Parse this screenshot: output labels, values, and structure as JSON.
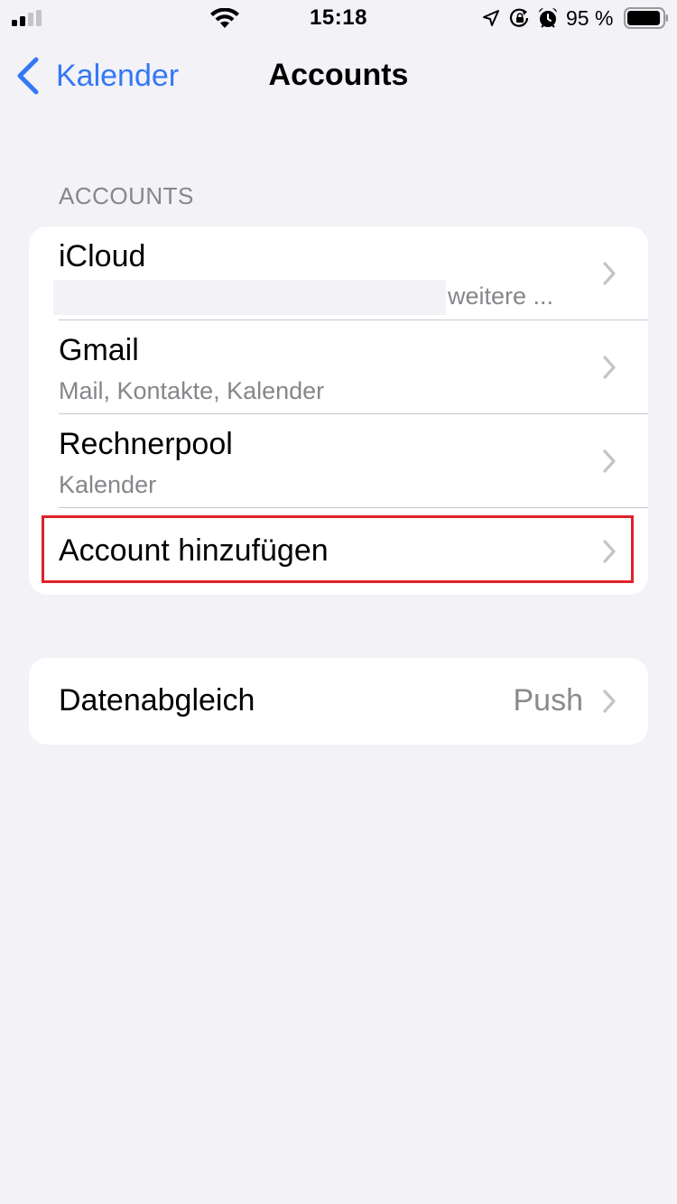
{
  "status_bar": {
    "time": "15:18",
    "battery_text": "95 %",
    "battery_level": 0.95,
    "signal_bars_active": 2,
    "signal_bars_total": 4,
    "icons": [
      "signal-icon",
      "wifi-icon",
      "location-icon",
      "rotation-lock-icon",
      "alarm-icon",
      "battery-icon"
    ]
  },
  "nav": {
    "back_label": "Kalender",
    "title": "Accounts"
  },
  "accounts_section": {
    "header": "ACCOUNTS",
    "items": [
      {
        "title": "iCloud",
        "subtitle": "weitere ..."
      },
      {
        "title": "Gmail",
        "subtitle": "Mail, Kontakte, Kalender"
      },
      {
        "title": "Rechnerpool",
        "subtitle": "Kalender"
      },
      {
        "title": "Account hinzufügen"
      }
    ]
  },
  "sync_section": {
    "label": "Datenabgleich",
    "value": "Push"
  },
  "colors": {
    "accent": "#3478f6",
    "background": "#f2f2f7",
    "highlight": "#e0202a"
  }
}
